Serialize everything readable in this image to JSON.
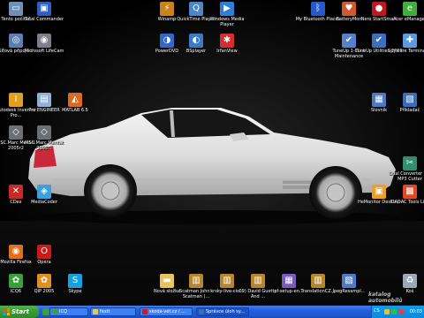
{
  "desktop": {
    "icons": [
      {
        "id": "my-computer",
        "label": "Tento počítač",
        "icon": "computer-icon",
        "color": "#6d8fb8",
        "sym": "▭"
      },
      {
        "id": "total-commander",
        "label": "Total Commander",
        "icon": "floppy-icon",
        "color": "#2d5ec2",
        "sym": "▣"
      },
      {
        "id": "winamp",
        "label": "Winamp",
        "icon": "winamp-icon",
        "color": "#c9831a",
        "sym": "⚡"
      },
      {
        "id": "quicktime",
        "label": "QuickTime Player",
        "icon": "quicktime-icon",
        "color": "#4a86c8",
        "sym": "Q"
      },
      {
        "id": "wmp",
        "label": "Windows Media Player",
        "icon": "media-player-icon",
        "color": "#2f7fd8",
        "sym": "▶"
      },
      {
        "id": "bluetooth",
        "label": "My Bluetooth Places",
        "icon": "bluetooth-icon",
        "color": "#2859c9",
        "sym": "ᛒ"
      },
      {
        "id": "batterymon",
        "label": "BatteryMon",
        "icon": "battery-icon",
        "color": "#d05a30",
        "sym": "♥"
      },
      {
        "id": "nero",
        "label": "Nero StartSmart",
        "icon": "nero-icon",
        "color": "#c4161c",
        "sym": "●"
      },
      {
        "id": "emanager",
        "label": "Acer eManager",
        "icon": "acer-icon",
        "color": "#3fae3c",
        "sym": "e"
      },
      {
        "id": "network",
        "label": "Síťová připojení",
        "icon": "network-icon",
        "color": "#5b7fb3",
        "sym": "◎"
      },
      {
        "id": "lifecam",
        "label": "Microsoft LifeCam",
        "icon": "webcam-icon",
        "color": "#7a7f88",
        "sym": "◉"
      },
      {
        "id": "powerdvd",
        "label": "PowerDVD",
        "icon": "dvd-icon",
        "color": "#3267c8",
        "sym": "◑"
      },
      {
        "id": "bsplayer",
        "label": "BSplayer",
        "icon": "bsplayer-icon",
        "color": "#3a7bc8",
        "sym": "◐"
      },
      {
        "id": "irfanview",
        "label": "IrfanView",
        "icon": "irfanview-icon",
        "color": "#d23030",
        "sym": "✱"
      },
      {
        "id": "tuneup-maint",
        "label": "TuneUp 1-Click Maintenance",
        "icon": "tuneup-icon",
        "color": "#5581c9",
        "sym": "✔"
      },
      {
        "id": "tuneup-util",
        "label": "TuneUp Utilities 2009",
        "icon": "tuneup-icon",
        "color": "#3c6fc2",
        "sym": "✔"
      },
      {
        "id": "spyware",
        "label": "Spyware Terminator",
        "icon": "shield-icon",
        "color": "#5a9be0",
        "sym": "✚"
      },
      {
        "id": "inventor",
        "label": "Autodesk Inventor Pro...",
        "icon": "inventor-icon",
        "color": "#e0a020",
        "sym": "I"
      },
      {
        "id": "proengineer",
        "label": "Pro ENGINEER",
        "icon": "proengineer-icon",
        "color": "#8fb1d8",
        "sym": "▤"
      },
      {
        "id": "matlab",
        "label": "MATLAB 6.5",
        "icon": "matlab-icon",
        "color": "#d86b1f",
        "sym": "◭"
      },
      {
        "id": "slovnik",
        "label": "Slovník",
        "icon": "dictionary-icon",
        "color": "#4f78c0",
        "sym": "▦"
      },
      {
        "id": "prikladac",
        "label": "Přikladač",
        "icon": "calculator-icon",
        "color": "#3a6db8",
        "sym": "▧"
      },
      {
        "id": "marc1",
        "label": "MSC.Marc Mentat 2005r2",
        "icon": "msc-icon",
        "color": "#6c6f75",
        "sym": "◇"
      },
      {
        "id": "marc2",
        "label": "MSC.Marc Mentat 2005...",
        "icon": "msc-icon",
        "color": "#6c6f75",
        "sym": "◇"
      },
      {
        "id": "dvdcutter",
        "label": "Dual Converter Pro MP3 Cutter",
        "icon": "mp3-cutter-icon",
        "color": "#2f8f6f",
        "sym": "✂"
      },
      {
        "id": "cdex",
        "label": "CDex",
        "icon": "cdex-icon",
        "color": "#c82a2a",
        "sym": "✕"
      },
      {
        "id": "mediacoder",
        "label": "MediaCoder",
        "icon": "mediacoder-icon",
        "color": "#3aa0e0",
        "sym": "◈"
      },
      {
        "id": "hmonitor",
        "label": "HeMonitor Desktop",
        "icon": "monitor-icon",
        "color": "#f0a020",
        "sym": "▣"
      },
      {
        "id": "dadacrt",
        "label": "DADAC Tools Lite",
        "icon": "tools-icon",
        "color": "#e04a20",
        "sym": "▩"
      },
      {
        "id": "firefox",
        "label": "Mozilla Firefox",
        "icon": "firefox-icon",
        "color": "#e0701a",
        "sym": "◉"
      },
      {
        "id": "opera",
        "label": "Opera",
        "icon": "opera-icon",
        "color": "#cc1a1a",
        "sym": "O"
      },
      {
        "id": "icq6",
        "label": "ICQ6",
        "icon": "icq-icon",
        "color": "#3aa03a",
        "sym": "✿"
      },
      {
        "id": "qip",
        "label": "QIP 2005",
        "icon": "qip-icon",
        "color": "#e09020",
        "sym": "✿"
      },
      {
        "id": "skype",
        "label": "Skype",
        "icon": "skype-icon",
        "color": "#16a0e0",
        "sym": "S"
      },
      {
        "id": "nova-slozka",
        "label": "Nová složka",
        "icon": "folder-icon",
        "color": "#e8c45a",
        "sym": "▬"
      },
      {
        "id": "file1",
        "label": "Scatman John - Scatman (...",
        "icon": "winrar-icon",
        "color": "#b8862a",
        "sym": "▥"
      },
      {
        "id": "file2",
        "label": "krsky-live-cio...",
        "icon": "winrar-icon",
        "color": "#b8862a",
        "sym": "▥"
      },
      {
        "id": "file3",
        "label": "09) David Guetta And ...",
        "icon": "winrar-icon",
        "color": "#b8862a",
        "sym": "▥"
      },
      {
        "id": "file4",
        "label": "pf-setup-en...",
        "icon": "installer-icon",
        "color": "#7a5ac0",
        "sym": "▦"
      },
      {
        "id": "file5",
        "label": "TranslationCZ...",
        "icon": "archive-icon",
        "color": "#b8862a",
        "sym": "▥"
      },
      {
        "id": "file6",
        "label": "JpegResampl...",
        "icon": "image-tool-icon",
        "color": "#4a7ac8",
        "sym": "▨"
      },
      {
        "id": "recycle",
        "label": "Koš",
        "icon": "recycle-bin-icon",
        "color": "#9aa8b8",
        "sym": "♻"
      }
    ]
  },
  "taskbar": {
    "start_label": "Start",
    "tasks": [
      {
        "label": "ICQ",
        "icon": "icq-icon",
        "color": "#3aa03a"
      },
      {
        "label": "fextt",
        "icon": "folder-icon",
        "color": "#e8c45a"
      },
      {
        "label": "skoda-vet.cz / ...",
        "icon": "browser-icon",
        "color": "#cc1a1a"
      },
      {
        "label": "Správce úloh sy...",
        "icon": "task-manager-icon",
        "color": "#3a6db8"
      }
    ],
    "tray": {
      "language": "CS",
      "clock": "00:03"
    }
  },
  "watermark": "katalog automobilů"
}
